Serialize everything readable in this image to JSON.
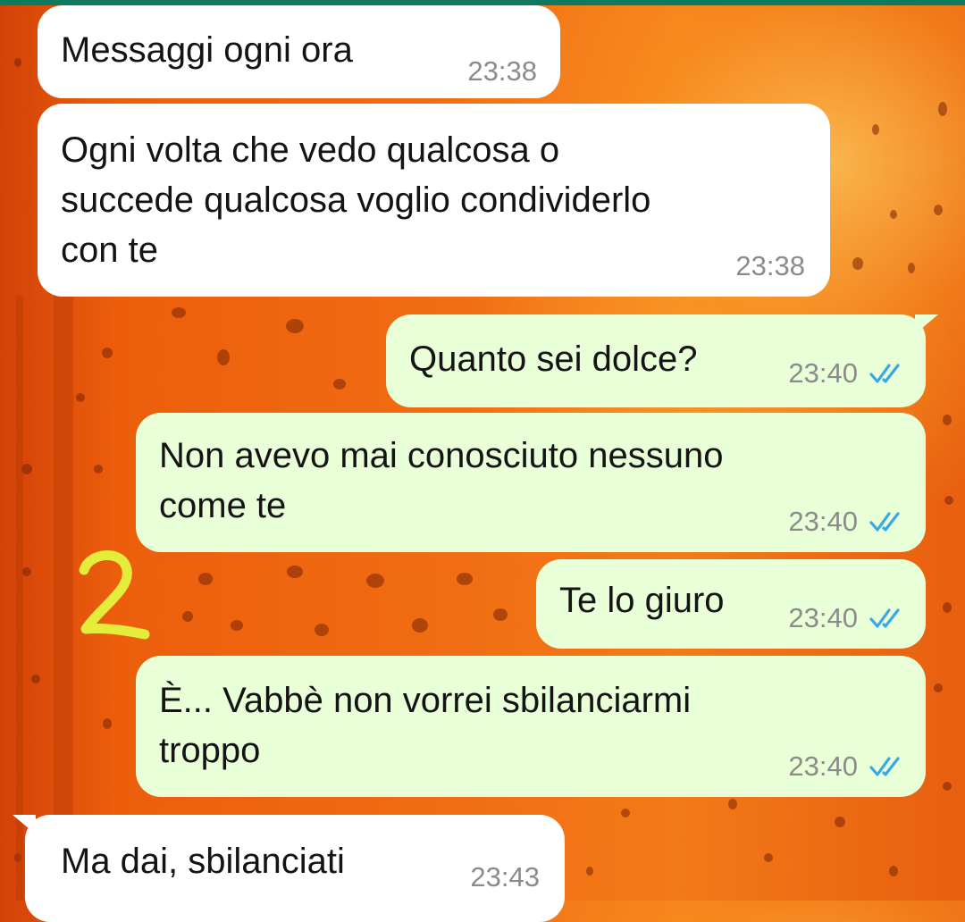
{
  "chat": {
    "messages": [
      {
        "direction": "incoming",
        "text": "Messaggi ogni ora",
        "time": "23:38"
      },
      {
        "direction": "incoming",
        "text": "Ogni volta che vedo qualcosa o\nsuccede qualcosa voglio condividerlo\ncon te",
        "time": "23:38"
      },
      {
        "direction": "outgoing",
        "text": "Quanto sei dolce?",
        "time": "23:40",
        "status": "read"
      },
      {
        "direction": "outgoing",
        "text": "Non avevo mai conosciuto nessuno\ncome te",
        "time": "23:40",
        "status": "read"
      },
      {
        "direction": "outgoing",
        "text": "Te lo giuro",
        "time": "23:40",
        "status": "read"
      },
      {
        "direction": "outgoing",
        "text": "È... Vabbè non vorrei sbilanciarmi\ntroppo",
        "time": "23:40",
        "status": "read"
      },
      {
        "direction": "incoming",
        "text": "Ma dai, sbilanciati",
        "time": "23:43"
      }
    ]
  },
  "annotation": {
    "text": "2",
    "color": "#e4ec3c"
  },
  "colors": {
    "incoming_bubble": "#ffffff",
    "outgoing_bubble": "#e8ffd8",
    "read_ticks": "#3aa7e8",
    "timestamp": "#8b8b8b",
    "wallpaper": "#f06a12"
  },
  "icons": {
    "read_receipt": "double-check-icon"
  }
}
